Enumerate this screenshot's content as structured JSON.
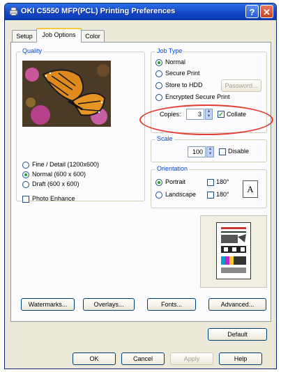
{
  "window": {
    "title": "OKI C5550 MFP(PCL) Printing Preferences",
    "help_label": "?",
    "close_label": "✕"
  },
  "tabs": [
    {
      "label": "Setup"
    },
    {
      "label": "Job Options"
    },
    {
      "label": "Color"
    }
  ],
  "quality": {
    "label": "Quality",
    "options": [
      {
        "label": "Fine / Detail (1200x600)"
      },
      {
        "label": "Normal (600 x 600)"
      },
      {
        "label": "Draft (600 x 600)"
      }
    ],
    "selected": "Normal (600 x 600)",
    "photo_enhance_label": "Photo Enhance"
  },
  "job_type": {
    "label": "Job Type",
    "options": [
      {
        "label": "Normal"
      },
      {
        "label": "Secure Print"
      },
      {
        "label": "Store to HDD"
      },
      {
        "label": "Encrypted Secure Print"
      }
    ],
    "password_label": "Password...",
    "copies_label": "Copies:",
    "copies_value": "3",
    "collate_label": "Collate"
  },
  "scale": {
    "label": "Scale",
    "value": "100",
    "disable_label": "Disable"
  },
  "orientation": {
    "label": "Orientation",
    "portrait_label": "Portrait",
    "landscape_label": "Landscape",
    "rotate_label": "180°",
    "page_glyph": "A"
  },
  "buttons": {
    "watermarks": "Watermarks...",
    "overlays": "Overlays...",
    "fonts": "Fonts...",
    "advanced": "Advanced...",
    "default": "Default",
    "ok": "OK",
    "cancel": "Cancel",
    "apply": "Apply",
    "help": "Help"
  },
  "colors": {
    "accent": "#0046d5",
    "title_bar": "#1245c9",
    "highlight": "#e23b2f"
  }
}
